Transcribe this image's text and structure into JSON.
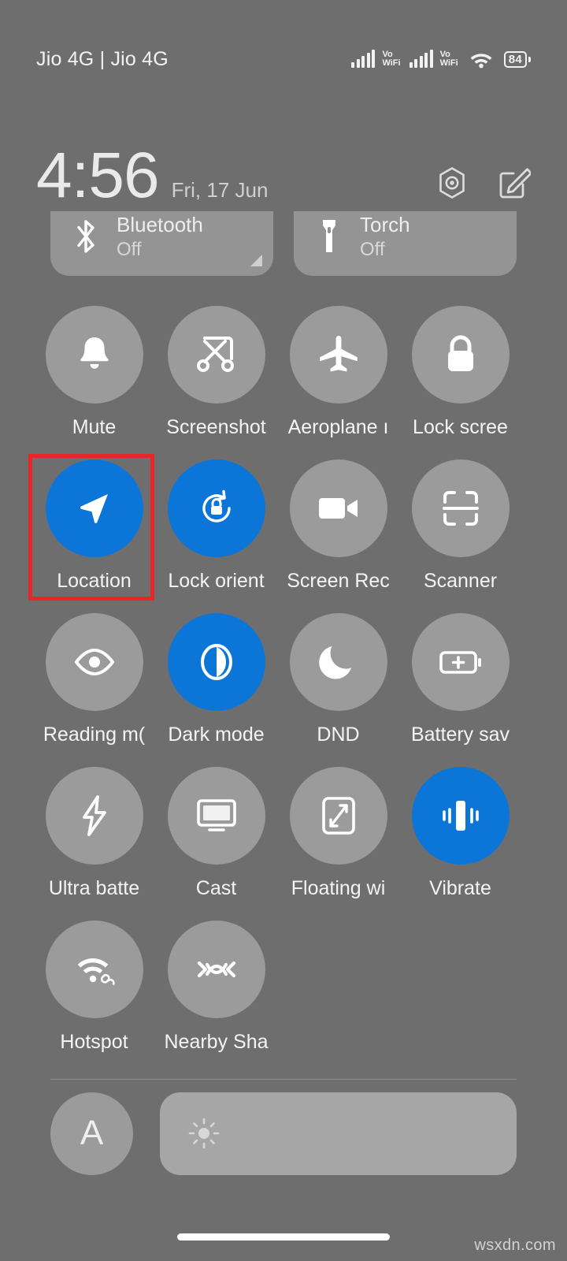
{
  "statusbar": {
    "carrier": "Jio 4G | Jio 4G",
    "volte_top": "Vo",
    "volte_bottom": "WiFi",
    "battery_percent": "84"
  },
  "header": {
    "time": "4:56",
    "date": "Fri, 17 Jun",
    "settings_icon": "gear-hexagon-icon",
    "edit_icon": "edit-pencil-icon"
  },
  "top_cards": [
    {
      "title": "Bluetooth",
      "status": "Off",
      "icon": "bluetooth-icon",
      "active": false,
      "has_expand": true
    },
    {
      "title": "Torch",
      "status": "Off",
      "icon": "torch-icon",
      "active": false,
      "has_expand": false
    }
  ],
  "tiles": [
    {
      "label": "Mute",
      "icon": "bell-icon",
      "active": false
    },
    {
      "label": "Screenshot",
      "icon": "scissors-icon",
      "active": false
    },
    {
      "label": "Aeroplane ı",
      "icon": "aeroplane-icon",
      "active": false
    },
    {
      "label": "Lock scree",
      "icon": "lock-icon",
      "active": false
    },
    {
      "label": "Location",
      "icon": "location-arrow-icon",
      "active": true
    },
    {
      "label": "Lock orient",
      "icon": "lock-rotation-icon",
      "active": true
    },
    {
      "label": "Screen Rec",
      "icon": "video-camera-icon",
      "active": false
    },
    {
      "label": "Scanner",
      "icon": "scan-frame-icon",
      "active": false
    },
    {
      "label": "Reading m(",
      "icon": "eye-icon",
      "active": false
    },
    {
      "label": "Dark mode",
      "icon": "contrast-circle-icon",
      "active": true
    },
    {
      "label": "DND",
      "icon": "moon-icon",
      "active": false
    },
    {
      "label": "Battery sav",
      "icon": "battery-plus-icon",
      "active": false
    },
    {
      "label": "Ultra batte",
      "icon": "lightning-bolt-icon",
      "active": false
    },
    {
      "label": "Cast",
      "icon": "monitor-icon",
      "active": false
    },
    {
      "label": "Floating wi",
      "icon": "floating-window-icon",
      "active": false
    },
    {
      "label": "Vibrate",
      "icon": "vibrate-icon",
      "active": true
    },
    {
      "label": "Hotspot",
      "icon": "hotspot-icon",
      "active": false
    },
    {
      "label": "Nearby Sha",
      "icon": "nearby-share-icon",
      "active": false
    }
  ],
  "highlight": {
    "target_label": "Location",
    "color": "#e8262a"
  },
  "brightness": {
    "auto_label": "A",
    "slider_icon": "sun-brightness-icon"
  },
  "footer": {
    "watermark": "wsxdn.com"
  },
  "colors": {
    "background": "#6e6e6e",
    "tile_inactive": "#9b9b9b",
    "tile_active": "#0c76d8",
    "text": "#f4f4f4",
    "highlight": "#e8262a"
  }
}
